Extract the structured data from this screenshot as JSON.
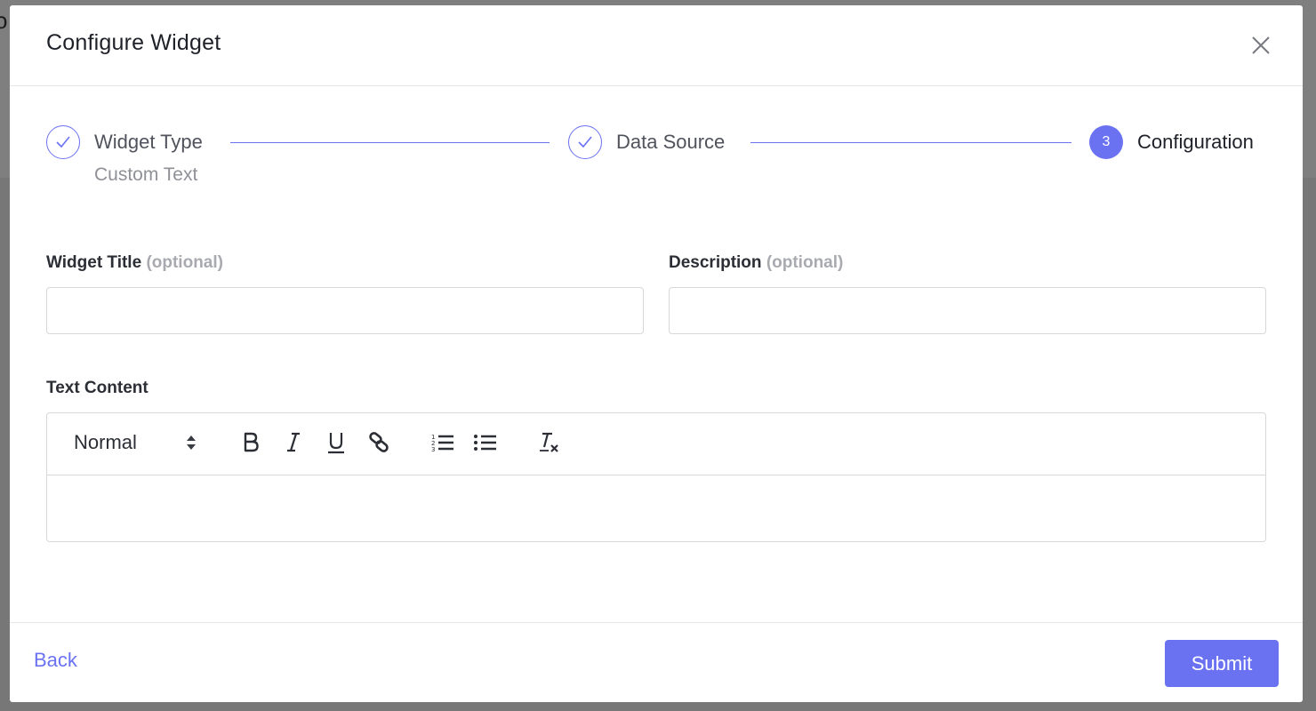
{
  "modal": {
    "title": "Configure Widget"
  },
  "stepper": {
    "steps": [
      {
        "label": "Widget Type",
        "sublabel": "Custom Text",
        "status": "complete"
      },
      {
        "label": "Data Source",
        "status": "complete"
      },
      {
        "label": "Configuration",
        "number": "3",
        "status": "active"
      }
    ],
    "accent_color": "#6b72f2"
  },
  "form": {
    "widget_title": {
      "label": "Widget Title",
      "optional": "(optional)",
      "value": ""
    },
    "description": {
      "label": "Description",
      "optional": "(optional)",
      "value": ""
    },
    "text_content": {
      "label": "Text Content",
      "format_select": "Normal",
      "toolbar_icons": [
        "bold-icon",
        "italic-icon",
        "underline-icon",
        "link-icon",
        "ordered-list-icon",
        "bullet-list-icon",
        "clear-format-icon"
      ],
      "value": ""
    }
  },
  "footer": {
    "back_label": "Back",
    "submit_label": "Submit"
  },
  "icons": {
    "close": "close-icon",
    "check": "check-icon",
    "select_arrows": "select-arrows-icon"
  }
}
